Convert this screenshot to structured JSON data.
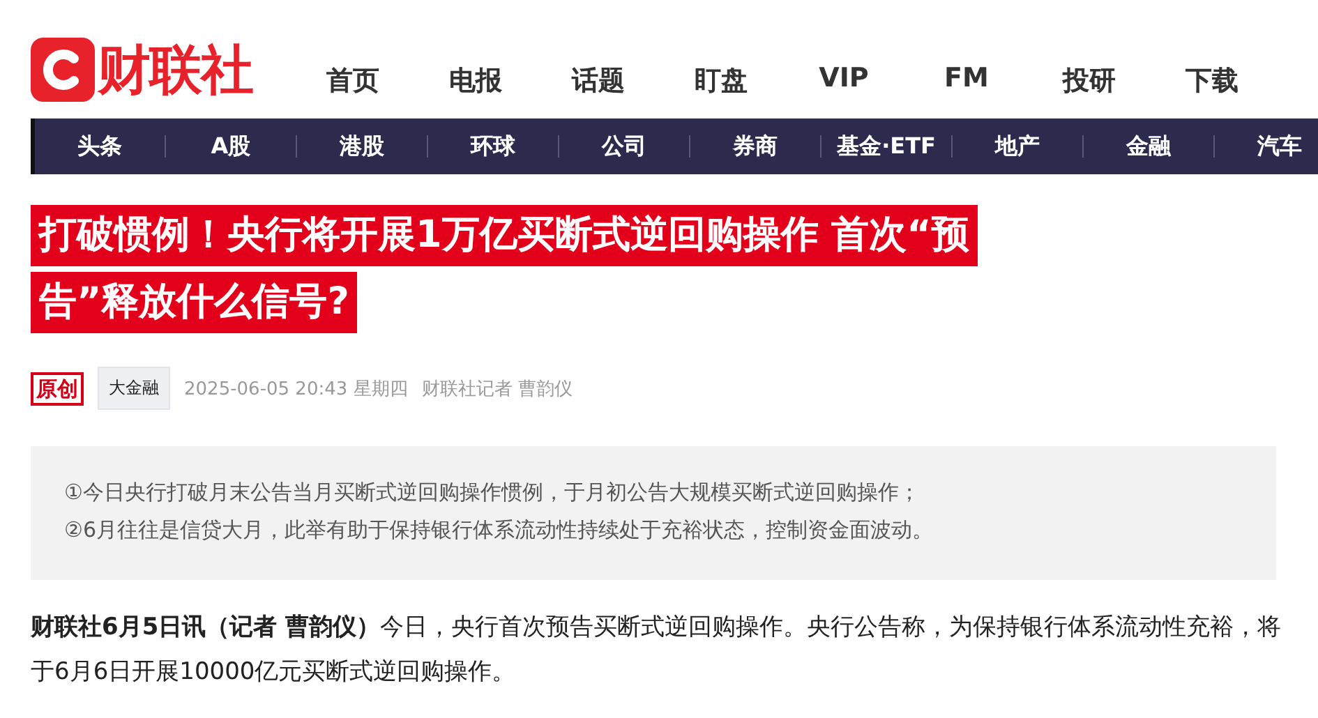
{
  "logo": {
    "name": "财联社"
  },
  "top_nav": [
    "首页",
    "电报",
    "话题",
    "盯盘",
    "VIP",
    "FM",
    "投研",
    "下载"
  ],
  "channel_nav": [
    "头条",
    "A股",
    "港股",
    "环球",
    "公司",
    "券商",
    "基金·ETF",
    "地产",
    "金融",
    "汽车"
  ],
  "article": {
    "title": [
      "打破惯例！央行将开展1万亿买断式逆回购操作 首次“预",
      "告”释放什么信号?"
    ],
    "badge": "原创",
    "tag": "大金融",
    "datetime": "2025-06-05 20:43 星期四",
    "author": "财联社记者 曹韵仪",
    "summary": [
      "①今日央行打破月末公告当月买断式逆回购操作惯例，于月初公告大规模买断式逆回购操作；",
      "②6月往往是信贷大月，此举有助于保持银行体系流动性持续处于充裕状态，控制资金面波动。"
    ],
    "body": "**财联社6月5日讯（记者 曹韵仪）**今日，央行首次预告买断式逆回购操作。央行公告称，为保持银行体系流动性充裕，将于6月6日开展10000亿元买断式逆回购操作。"
  }
}
